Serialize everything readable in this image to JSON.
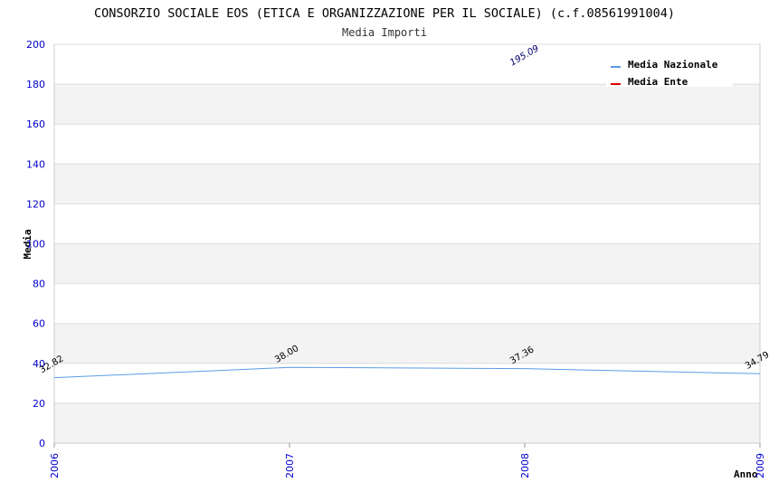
{
  "chart_data": {
    "type": "line",
    "title": "CONSORZIO SOCIALE EOS (ETICA E ORGANIZZAZIONE PER IL SOCIALE) (c.f.08561991004)",
    "subtitle": "Media Importi",
    "xlabel": "Anno",
    "ylabel": "Media",
    "categories": [
      "2006",
      "2007",
      "2008",
      "2009"
    ],
    "ylim": [
      0,
      200
    ],
    "yticks": [
      0,
      20,
      40,
      60,
      80,
      100,
      120,
      140,
      160,
      180,
      200
    ],
    "grid": true,
    "legend_position": "top-right",
    "series": [
      {
        "name": "Media Nazionale",
        "color": "#5b9ce6",
        "values": [
          32.82,
          38.0,
          37.36,
          34.79
        ],
        "labels": [
          "32.82",
          "38.00",
          "37.36",
          "34.79"
        ]
      },
      {
        "name": "Media Ente",
        "color": "#dd0000",
        "points": [
          {
            "x": "2008",
            "y": 195.09,
            "label": "195.09"
          }
        ]
      }
    ]
  }
}
